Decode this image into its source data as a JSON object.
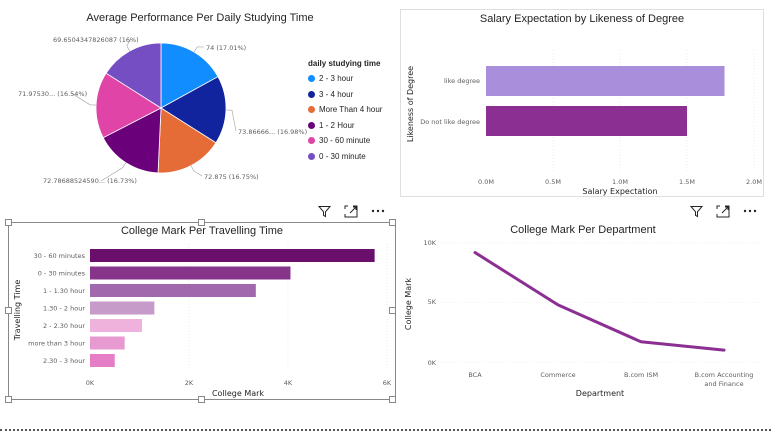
{
  "pie_visual": {
    "title": "Average Performance Per Daily Studying Time",
    "slice_labels": [
      "74 (17.01%)",
      "73.86666... (16.98%)",
      "72.875 (16.75%)",
      "72.78688524590... (16.73%)",
      "71.97530... (16.54%)",
      "69.6504347826087 (16%)"
    ],
    "legend_title": "daily studying time",
    "legend_items": [
      "2 - 3 hour",
      "3 - 4 hour",
      "More Than 4 hour",
      "1 - 2 Hour",
      "30 - 60 minute",
      "0 - 30 minute"
    ]
  },
  "salary_visual": {
    "title": "Salary Expectation by Likeness of Degree",
    "ylabel": "Likeness of Degree",
    "xlabel": "Salary Expectation",
    "categories": [
      "like degree",
      "Do not like degree"
    ],
    "ticks": [
      "0.0M",
      "0.5M",
      "1.0M",
      "1.5M",
      "2.0M"
    ]
  },
  "travel_visual": {
    "title": "College Mark Per Travelling Time",
    "ylabel": "Travelling Time",
    "xlabel": "College Mark",
    "categories": [
      "30 - 60 minutes",
      "0 - 30 minutes",
      "1 - 1.30 hour",
      "1.30 - 2 hour",
      "2 - 2.30 hour",
      "more than 3 hour",
      "2.30 - 3 hour"
    ],
    "ticks": [
      "0K",
      "2K",
      "4K",
      "6K"
    ]
  },
  "dept_visual": {
    "title": "College Mark Per Department",
    "ylabel": "College Mark",
    "xlabel": "Department",
    "categories": [
      "BCA",
      "Commerce",
      "B.com ISM",
      "B.com Accounting",
      "and Finance"
    ],
    "ticks": [
      "10K",
      "5K",
      "0K"
    ]
  },
  "toolbar": {
    "icons": [
      "filter-icon",
      "focus-mode-icon",
      "more-options-icon"
    ]
  },
  "colors": {
    "accent": "#742774",
    "selection_border": "#8a8886"
  },
  "chart_data": [
    {
      "type": "pie",
      "title": "Average Performance Per Daily Studying Time",
      "categories": [
        "2 - 3 hour",
        "3 - 4 hour",
        "72.875 slice",
        "72.787 slice",
        "71.975 slice",
        "69.650 slice"
      ],
      "values": [
        74,
        73.8667,
        72.875,
        72.7869,
        71.9753,
        69.6504
      ],
      "colors": [
        "#118dff",
        "#12239e",
        "#e66c37",
        "#6b007b",
        "#e044a7",
        "#744ec2"
      ]
    },
    {
      "type": "bar",
      "title": "Salary Expectation by Likeness of Degree",
      "xlabel": "Salary Expectation",
      "ylabel": "Likeness of Degree",
      "categories": [
        "like degree",
        "Do not like degree"
      ],
      "values": [
        1780000,
        1500000
      ],
      "xlim": [
        0,
        2000000
      ],
      "colors": [
        "#a98fdb",
        "#8b2f92"
      ]
    },
    {
      "type": "bar",
      "title": "College Mark Per Travelling Time",
      "xlabel": "College Mark",
      "ylabel": "Travelling Time",
      "categories": [
        "30 - 60 minutes",
        "0 - 30 minutes",
        "1 - 1.30 hour",
        "1.30 - 2 hour",
        "2 - 2.30 hour",
        "more than 3 hour",
        "2.30 - 3 hour"
      ],
      "values": [
        5750,
        4050,
        3350,
        1300,
        1050,
        700,
        500
      ],
      "xlim": [
        0,
        6000
      ],
      "colors": [
        "#6b0f6d",
        "#86358b",
        "#a268ad",
        "#c69ac9",
        "#efb2dd",
        "#e79ad0",
        "#e57ec7"
      ]
    },
    {
      "type": "line",
      "title": "College Mark Per Department",
      "xlabel": "Department",
      "ylabel": "College Mark",
      "categories": [
        "BCA",
        "Commerce",
        "B.com ISM",
        "B.com Accounting and Finance"
      ],
      "values": [
        9200,
        4800,
        1700,
        1000
      ],
      "ylim": [
        0,
        10000
      ],
      "color": "#8b2f92"
    }
  ]
}
